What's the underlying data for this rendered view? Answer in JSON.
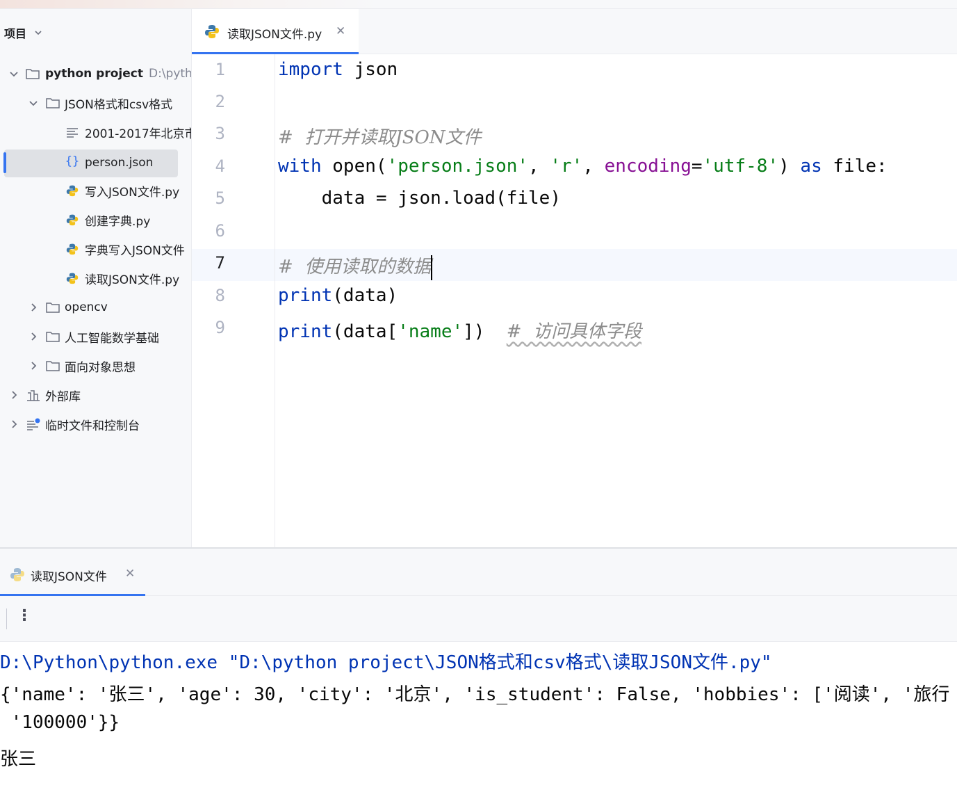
{
  "sidebar": {
    "title": "项目",
    "tree": {
      "root_name": "python project",
      "root_path": "D:\\pythor",
      "folder_json_csv": "JSON格式和csv格式",
      "file_txt": "2001-2017年北京市",
      "file_person_json": "person.json",
      "file_write_json": "写入JSON文件.py",
      "file_create_dict": "创建字典.py",
      "file_dict_to_json": "字典写入JSON文件",
      "file_read_json": "读取JSON文件.py",
      "folder_opencv": "opencv",
      "folder_ai_math": "人工智能数学基础",
      "folder_oop": "面向对象思想",
      "external_libs": "外部库",
      "scratches": "临时文件和控制台"
    }
  },
  "editor": {
    "tab_label": "读取JSON文件.py",
    "line_numbers": [
      "1",
      "2",
      "3",
      "4",
      "5",
      "6",
      "7",
      "8",
      "9"
    ],
    "code": {
      "l1_kw": "import",
      "l1_rest": " json",
      "l3_comment": "#  打开并读取JSON文件",
      "l4_with": "with",
      "l4_open": " open(",
      "l4_str1": "'person.json'",
      "l4_comma1": ", ",
      "l4_str2": "'r'",
      "l4_comma2": ", ",
      "l4_param": "encoding",
      "l4_eq": "=",
      "l4_str3": "'utf-8'",
      "l4_close": ") ",
      "l4_as": "as",
      "l4_rest": " file:",
      "l5": "    data = json.load(file)",
      "l7_comment": "#  使用读取的数据",
      "l8_kw": "print",
      "l8_rest": "(data)",
      "l9_kw": "print",
      "l9_open": "(data[",
      "l9_str": "'name'",
      "l9_close": "])  ",
      "l9_comment": "#  访问具体字段"
    }
  },
  "run_panel": {
    "tab_label": "读取JSON文件",
    "console": [
      "D:\\Python\\python.exe \"D:\\python project\\JSON格式和csv格式\\读取JSON文件.py\"",
      "{'name': '张三', 'age': 30, 'city': '北京', 'is_student': False, 'hobbies': ['阅读', '旅行",
      " '100000'}}",
      "张三"
    ]
  },
  "colors": {
    "accent": "#3574f0",
    "keyword": "#0033b3",
    "string": "#067d17",
    "param": "#871094",
    "comment": "#8c8c8c"
  }
}
